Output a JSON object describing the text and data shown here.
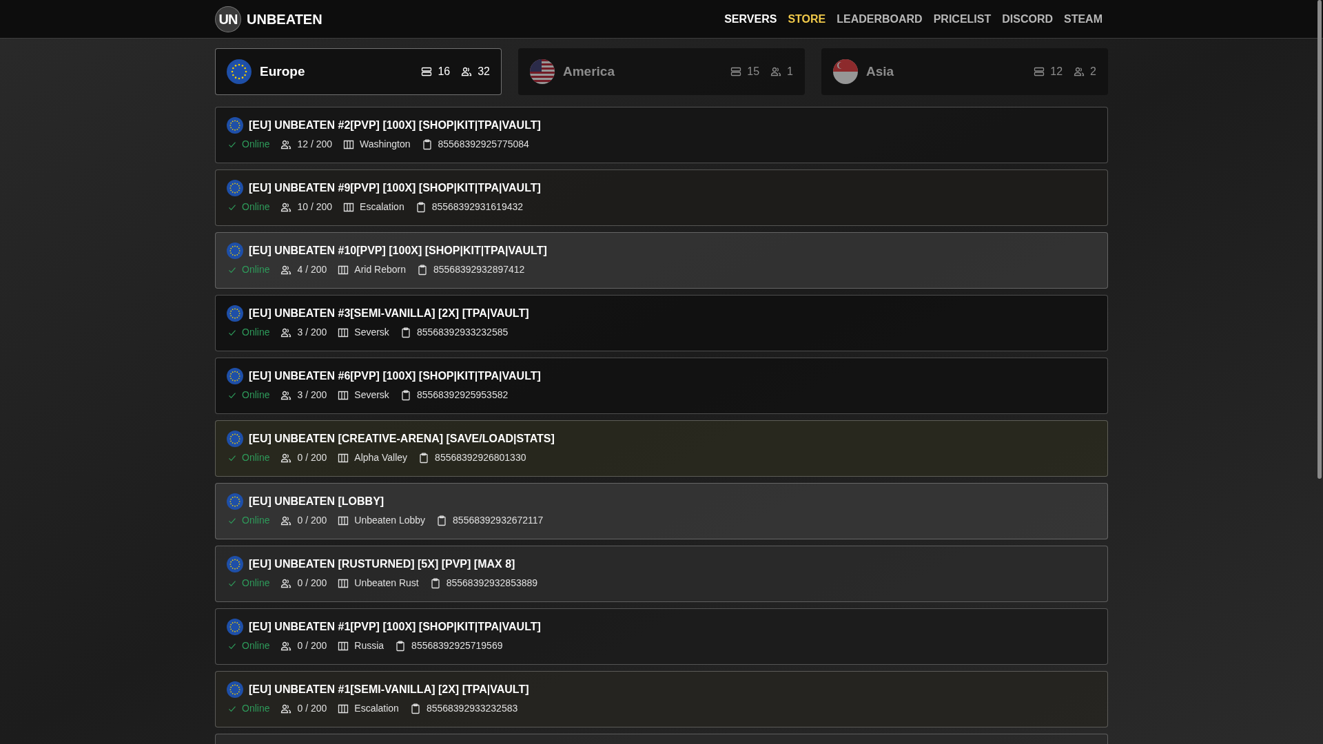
{
  "brand": {
    "logo": "UN",
    "name": "UNBEATEN"
  },
  "nav": [
    {
      "label": "SERVERS",
      "selected": true
    },
    {
      "label": "STORE",
      "selected": false,
      "kind": "accent"
    },
    {
      "label": "LEADERBOARD",
      "selected": false,
      "kind": "link"
    },
    {
      "label": "PRICELIST",
      "selected": false,
      "kind": "link"
    },
    {
      "label": "DISCORD",
      "selected": false,
      "kind": "link"
    },
    {
      "label": "STEAM",
      "selected": false,
      "kind": "link"
    }
  ],
  "regions": [
    {
      "name": "Europe",
      "kind": "eu",
      "servers": "16",
      "players": "32",
      "selected": true
    },
    {
      "name": "America",
      "kind": "us",
      "servers": "15",
      "players": "1",
      "selected": false
    },
    {
      "name": "Asia",
      "kind": "sg",
      "servers": "12",
      "players": "2",
      "selected": false
    }
  ],
  "servers": [
    {
      "title": "[EU] UNBEATEN #2[PVP] [100X] [SHOP|KIT|TPA|VAULT]",
      "status": "Online",
      "players": "12 / 200",
      "map": "Washington",
      "id": "85568392925775084"
    },
    {
      "title": "[EU] UNBEATEN #9[PVP] [100X] [SHOP|KIT|TPA|VAULT]",
      "status": "Online",
      "players": "10 / 200",
      "map": "Escalation",
      "id": "85568392931619432"
    },
    {
      "title": "[EU] UNBEATEN #10[PVP] [100X] [SHOP|KIT|TPA|VAULT]",
      "status": "Online",
      "players": "4 / 200",
      "map": "Arid Reborn",
      "id": "85568392932897412"
    },
    {
      "title": "[EU] UNBEATEN #3[SEMI-VANILLA] [2X] [TPA|VAULT]",
      "status": "Online",
      "players": "3 / 200",
      "map": "Seversk",
      "id": "85568392933232585"
    },
    {
      "title": "[EU] UNBEATEN #6[PVP] [100X] [SHOP|KIT|TPA|VAULT]",
      "status": "Online",
      "players": "3 / 200",
      "map": "Seversk",
      "id": "85568392925953582"
    },
    {
      "title": "[EU] UNBEATEN [CREATIVE-ARENA] [SAVE/LOAD|STATS]",
      "status": "Online",
      "players": "0 / 200",
      "map": "Alpha Valley",
      "id": "85568392926801330"
    },
    {
      "title": "[EU] UNBEATEN [LOBBY]",
      "status": "Online",
      "players": "0 / 200",
      "map": "Unbeaten Lobby",
      "id": "85568392932672117"
    },
    {
      "title": "[EU] UNBEATEN [RUSTURNED] [5X] [PVP] [MAX 8]",
      "status": "Online",
      "players": "0 / 200",
      "map": "Unbeaten Rust",
      "id": "85568392932853889"
    },
    {
      "title": "[EU] UNBEATEN #1[PVP] [100X] [SHOP|KIT|TPA|VAULT]",
      "status": "Online",
      "players": "0 / 200",
      "map": "Russia",
      "id": "85568392925719569"
    },
    {
      "title": "[EU] UNBEATEN #1[SEMI-VANILLA] [2X] [TPA|VAULT]",
      "status": "Online",
      "players": "0 / 200",
      "map": "Escalation",
      "id": "85568392933232583"
    }
  ]
}
